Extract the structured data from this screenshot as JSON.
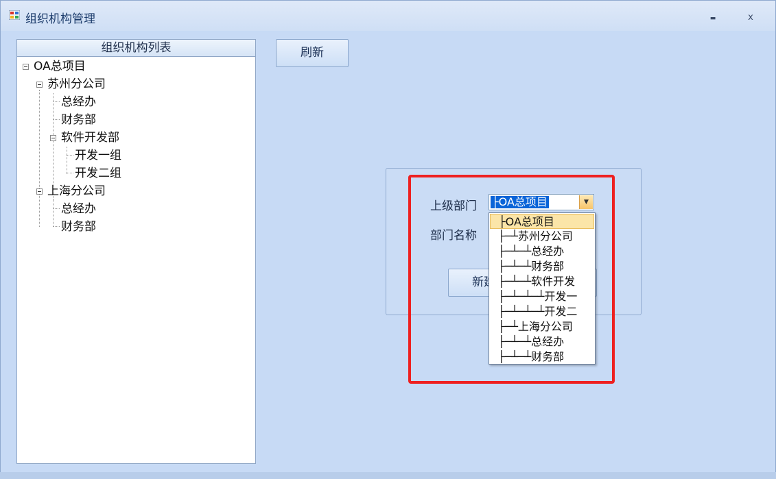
{
  "window": {
    "title": "组织机构管理",
    "minimize_symbol": "▬",
    "close_symbol": "x"
  },
  "tree": {
    "header": "组织机构列表",
    "nodes": [
      "OA总项目",
      "苏州分公司",
      "总经办",
      "财务部",
      "软件开发部",
      "开发一组",
      "开发二组",
      "上海分公司",
      "总经办",
      "财务部"
    ]
  },
  "toolbar": {
    "refresh_label": "刷新"
  },
  "form": {
    "parent_label": "上级部门",
    "name_label": "部门名称",
    "selected_parent": "├OA总项目",
    "create_label_visible": "新建"
  },
  "dropdown": {
    "items": [
      "├OA总项目",
      "├─┴苏州分公司",
      "├─┴─┴总经办",
      "├─┴─┴财务部",
      "├─┴─┴软件开发",
      "├─┴─┴─┴开发一",
      "├─┴─┴─┴开发二",
      "├─┴上海分公司",
      "├─┴─┴总经办",
      "├─┴─┴财务部"
    ],
    "highlighted_index": 0
  },
  "colors": {
    "window_bg": "#c7daf5",
    "highlight_border": "#ee2020",
    "selection": "#0a64d8",
    "hover": "#fbe5a8"
  }
}
